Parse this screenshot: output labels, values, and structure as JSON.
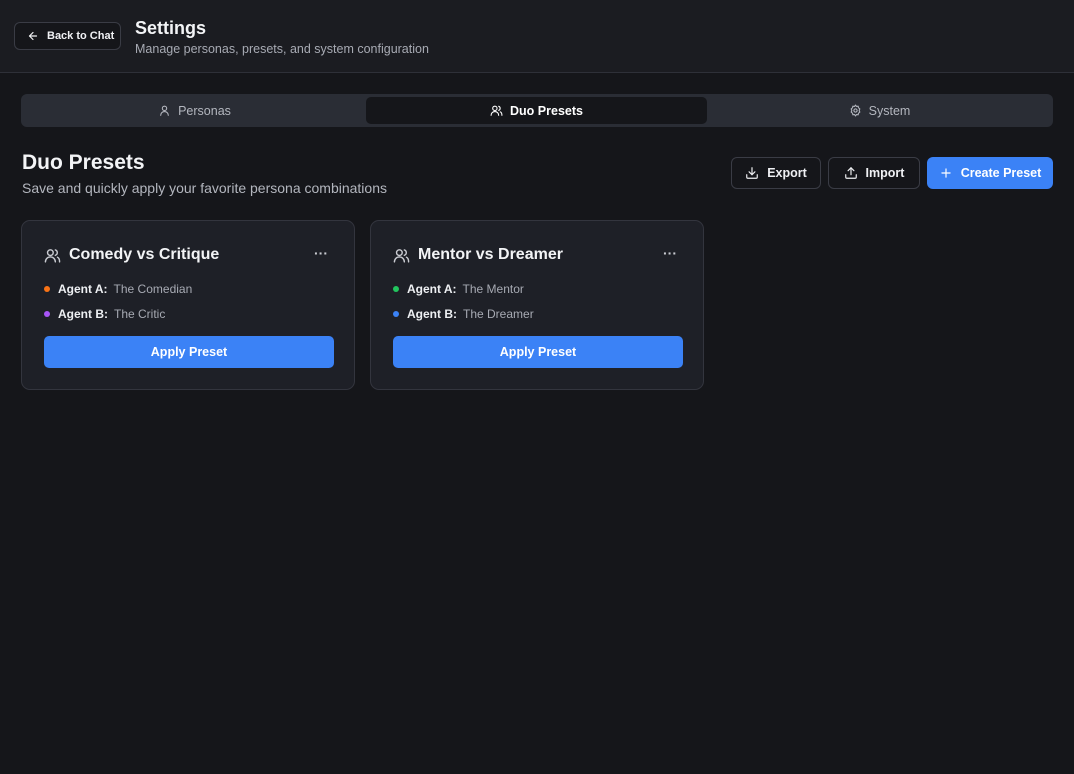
{
  "header": {
    "back_label": "Back to Chat",
    "title": "Settings",
    "subtitle": "Manage personas, presets, and system configuration"
  },
  "tabs": [
    {
      "label": "Personas",
      "icon": "user-icon",
      "active": false
    },
    {
      "label": "Duo Presets",
      "icon": "users-icon",
      "active": true
    },
    {
      "label": "System",
      "icon": "gear-icon",
      "active": false
    }
  ],
  "section": {
    "title": "Duo Presets",
    "subtitle": "Save and quickly apply your favorite persona combinations"
  },
  "actions": {
    "export_label": "Export",
    "import_label": "Import",
    "create_label": "Create Preset"
  },
  "presets": [
    {
      "title": "Comedy vs Critique",
      "more": "···",
      "agent_a_label": "Agent A:",
      "agent_a_name": "The Comedian",
      "agent_a_color": "#f97316",
      "agent_b_label": "Agent B:",
      "agent_b_name": "The Critic",
      "agent_b_color": "#a855f7",
      "apply_label": "Apply Preset"
    },
    {
      "title": "Mentor vs Dreamer",
      "more": "···",
      "agent_a_label": "Agent A:",
      "agent_a_name": "The Mentor",
      "agent_a_color": "#22c55e",
      "agent_b_label": "Agent B:",
      "agent_b_name": "The Dreamer",
      "agent_b_color": "#3b82f6",
      "apply_label": "Apply Preset"
    }
  ],
  "colors": {
    "accent": "#3b82f6",
    "background": "#15161a",
    "card": "#1e2027"
  }
}
